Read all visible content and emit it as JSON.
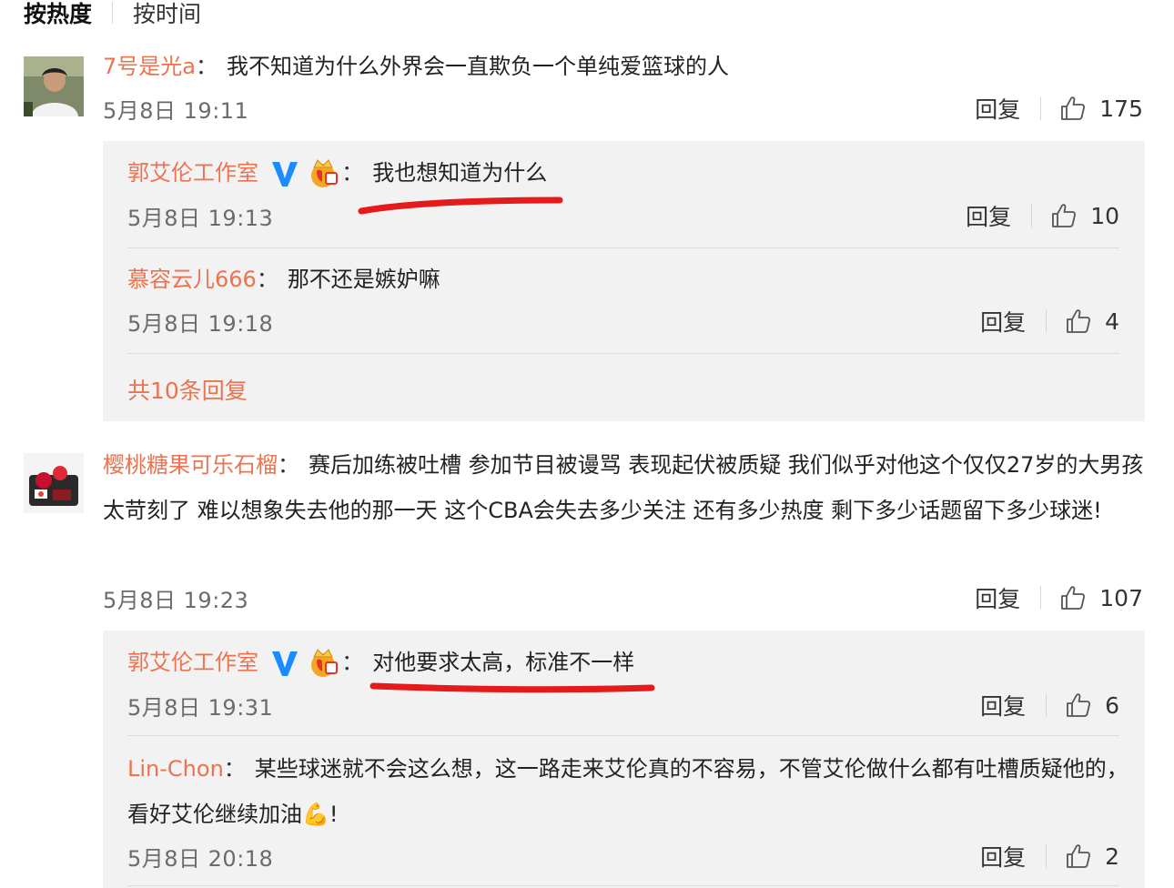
{
  "sort": {
    "active": "按热度",
    "inactive": "按时间"
  },
  "labels": {
    "reply": "回复"
  },
  "colors": {
    "username": "#eb7350",
    "underline": "#e51a1a",
    "verified": "#1a8cff"
  },
  "comment1": {
    "user": "7号是光a",
    "text": "我不知道为什么外界会一直欺负一个单纯爱篮球的人",
    "time": "5月8日 19:11",
    "likes": "175",
    "replies": [
      {
        "user": "郭艾伦工作室",
        "text": "我也想知道为什么",
        "time": "5月8日 19:13",
        "likes": "10"
      },
      {
        "user": "慕容云儿666",
        "text": "那不还是嫉妒嘛",
        "time": "5月8日 19:18",
        "likes": "4"
      }
    ],
    "more": "共10条回复"
  },
  "comment2": {
    "user": "樱桃糖果可乐石榴",
    "text": "赛后加练被吐槽 参加节目被谩骂 表现起伏被质疑 我们似乎对他这个仅仅27岁的大男孩太苛刻了 难以想象失去他的那一天 这个CBA会失去多少关注 还有多少热度 剩下多少话题留下多少球迷!",
    "time": "5月8日 19:23",
    "likes": "107",
    "replies": [
      {
        "user": "郭艾伦工作室",
        "text": "对他要求太高，标准不一样",
        "time": "5月8日 19:31",
        "likes": "6"
      },
      {
        "user": "Lin-Chon",
        "text": "某些球迷就不会这么想，这一路走来艾伦真的不容易，不管艾伦做什么都有吐槽质疑他的，看好艾伦继续加油",
        "emoji": "💪",
        "end": "!",
        "time": "5月8日 20:18",
        "likes": "2"
      }
    ]
  }
}
